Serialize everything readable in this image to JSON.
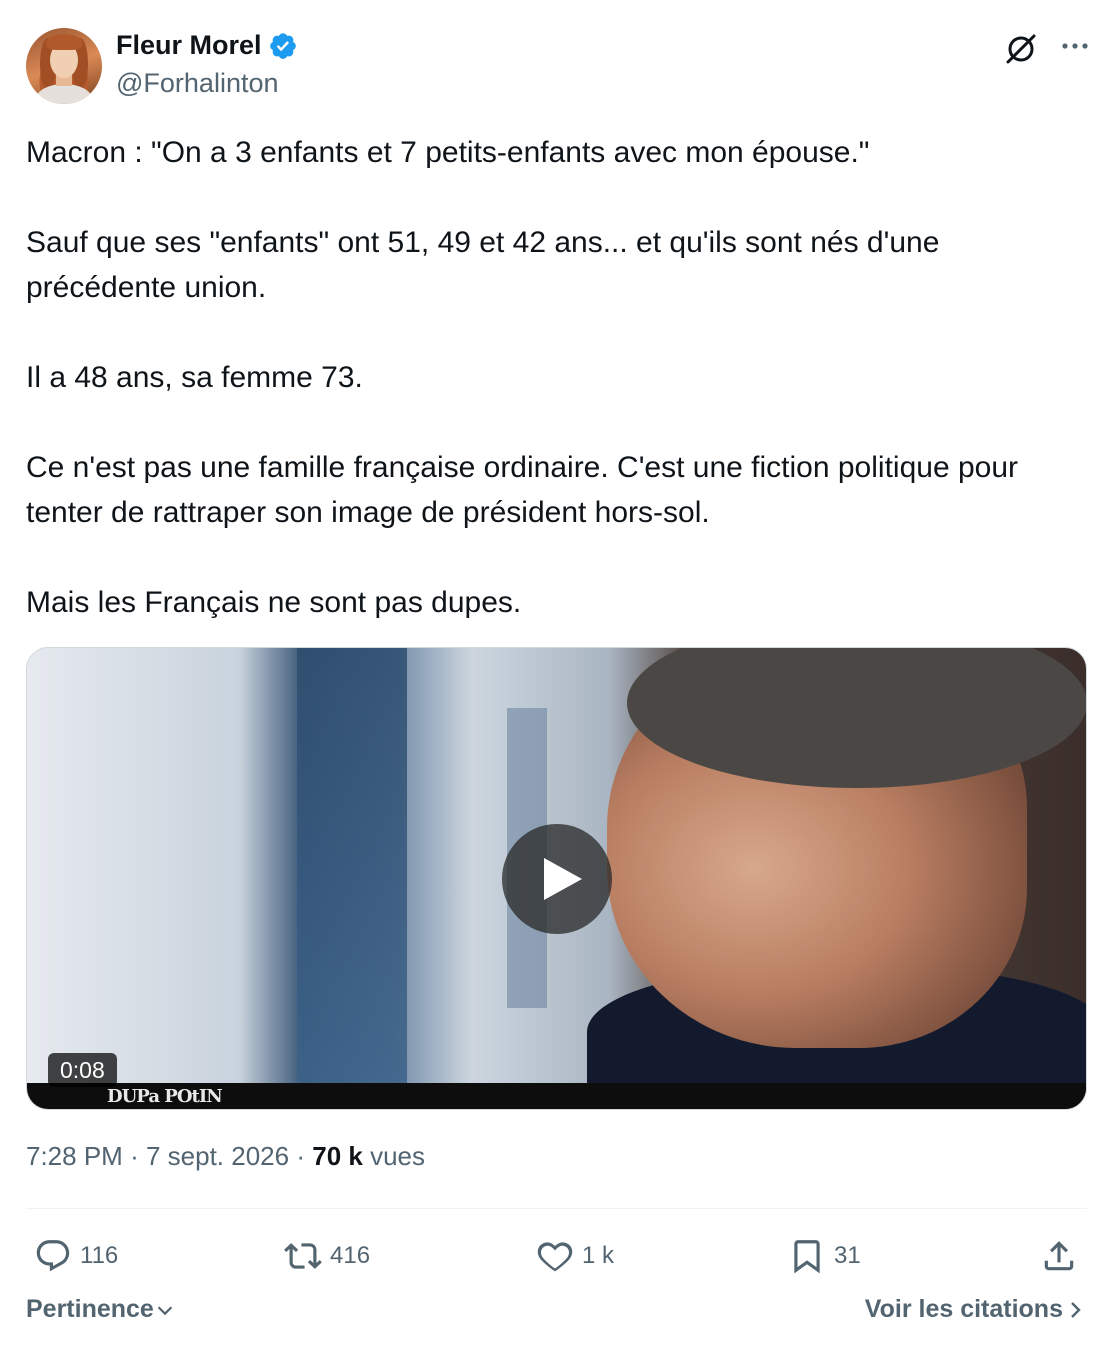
{
  "author": {
    "display_name": "Fleur Morel",
    "handle": "@Forhalinton",
    "verified": true
  },
  "tweet": {
    "text": "Macron : \"On a 3 enfants et 7 petits-enfants avec mon épouse.\"\n\nSauf que ses \"enfants\" ont 51, 49 et 42 ans... et qu'ils sont nés d'une précédente union.\n\nIl a 48 ans, sa femme 73.\n\nCe n'est pas une famille française ordinaire. C'est une fiction politique pour tenter de rattraper son image de président hors-sol.\n\nMais les Français ne sont pas dupes."
  },
  "media": {
    "duration": "0:08",
    "overlay_logo": "DUPa POtIN"
  },
  "meta": {
    "time": "7:28 PM",
    "separator": "·",
    "date": "7 sept. 2026",
    "views_count": "70 k",
    "views_label": "vues"
  },
  "actions": {
    "replies": "116",
    "reposts": "416",
    "likes": "1 k",
    "bookmarks": "31"
  },
  "footer": {
    "sort_label": "Pertinence",
    "quotes_label": "Voir les citations"
  },
  "colors": {
    "text_primary": "#0f1419",
    "text_secondary": "#536471",
    "verified_blue": "#1d9bf0",
    "divider": "#eff3f4"
  },
  "icons": [
    "verified-badge-icon",
    "grok-icon",
    "more-icon",
    "play-icon",
    "reply-icon",
    "repost-icon",
    "like-icon",
    "bookmark-icon",
    "share-icon",
    "chevron-down-icon",
    "chevron-right-icon"
  ]
}
